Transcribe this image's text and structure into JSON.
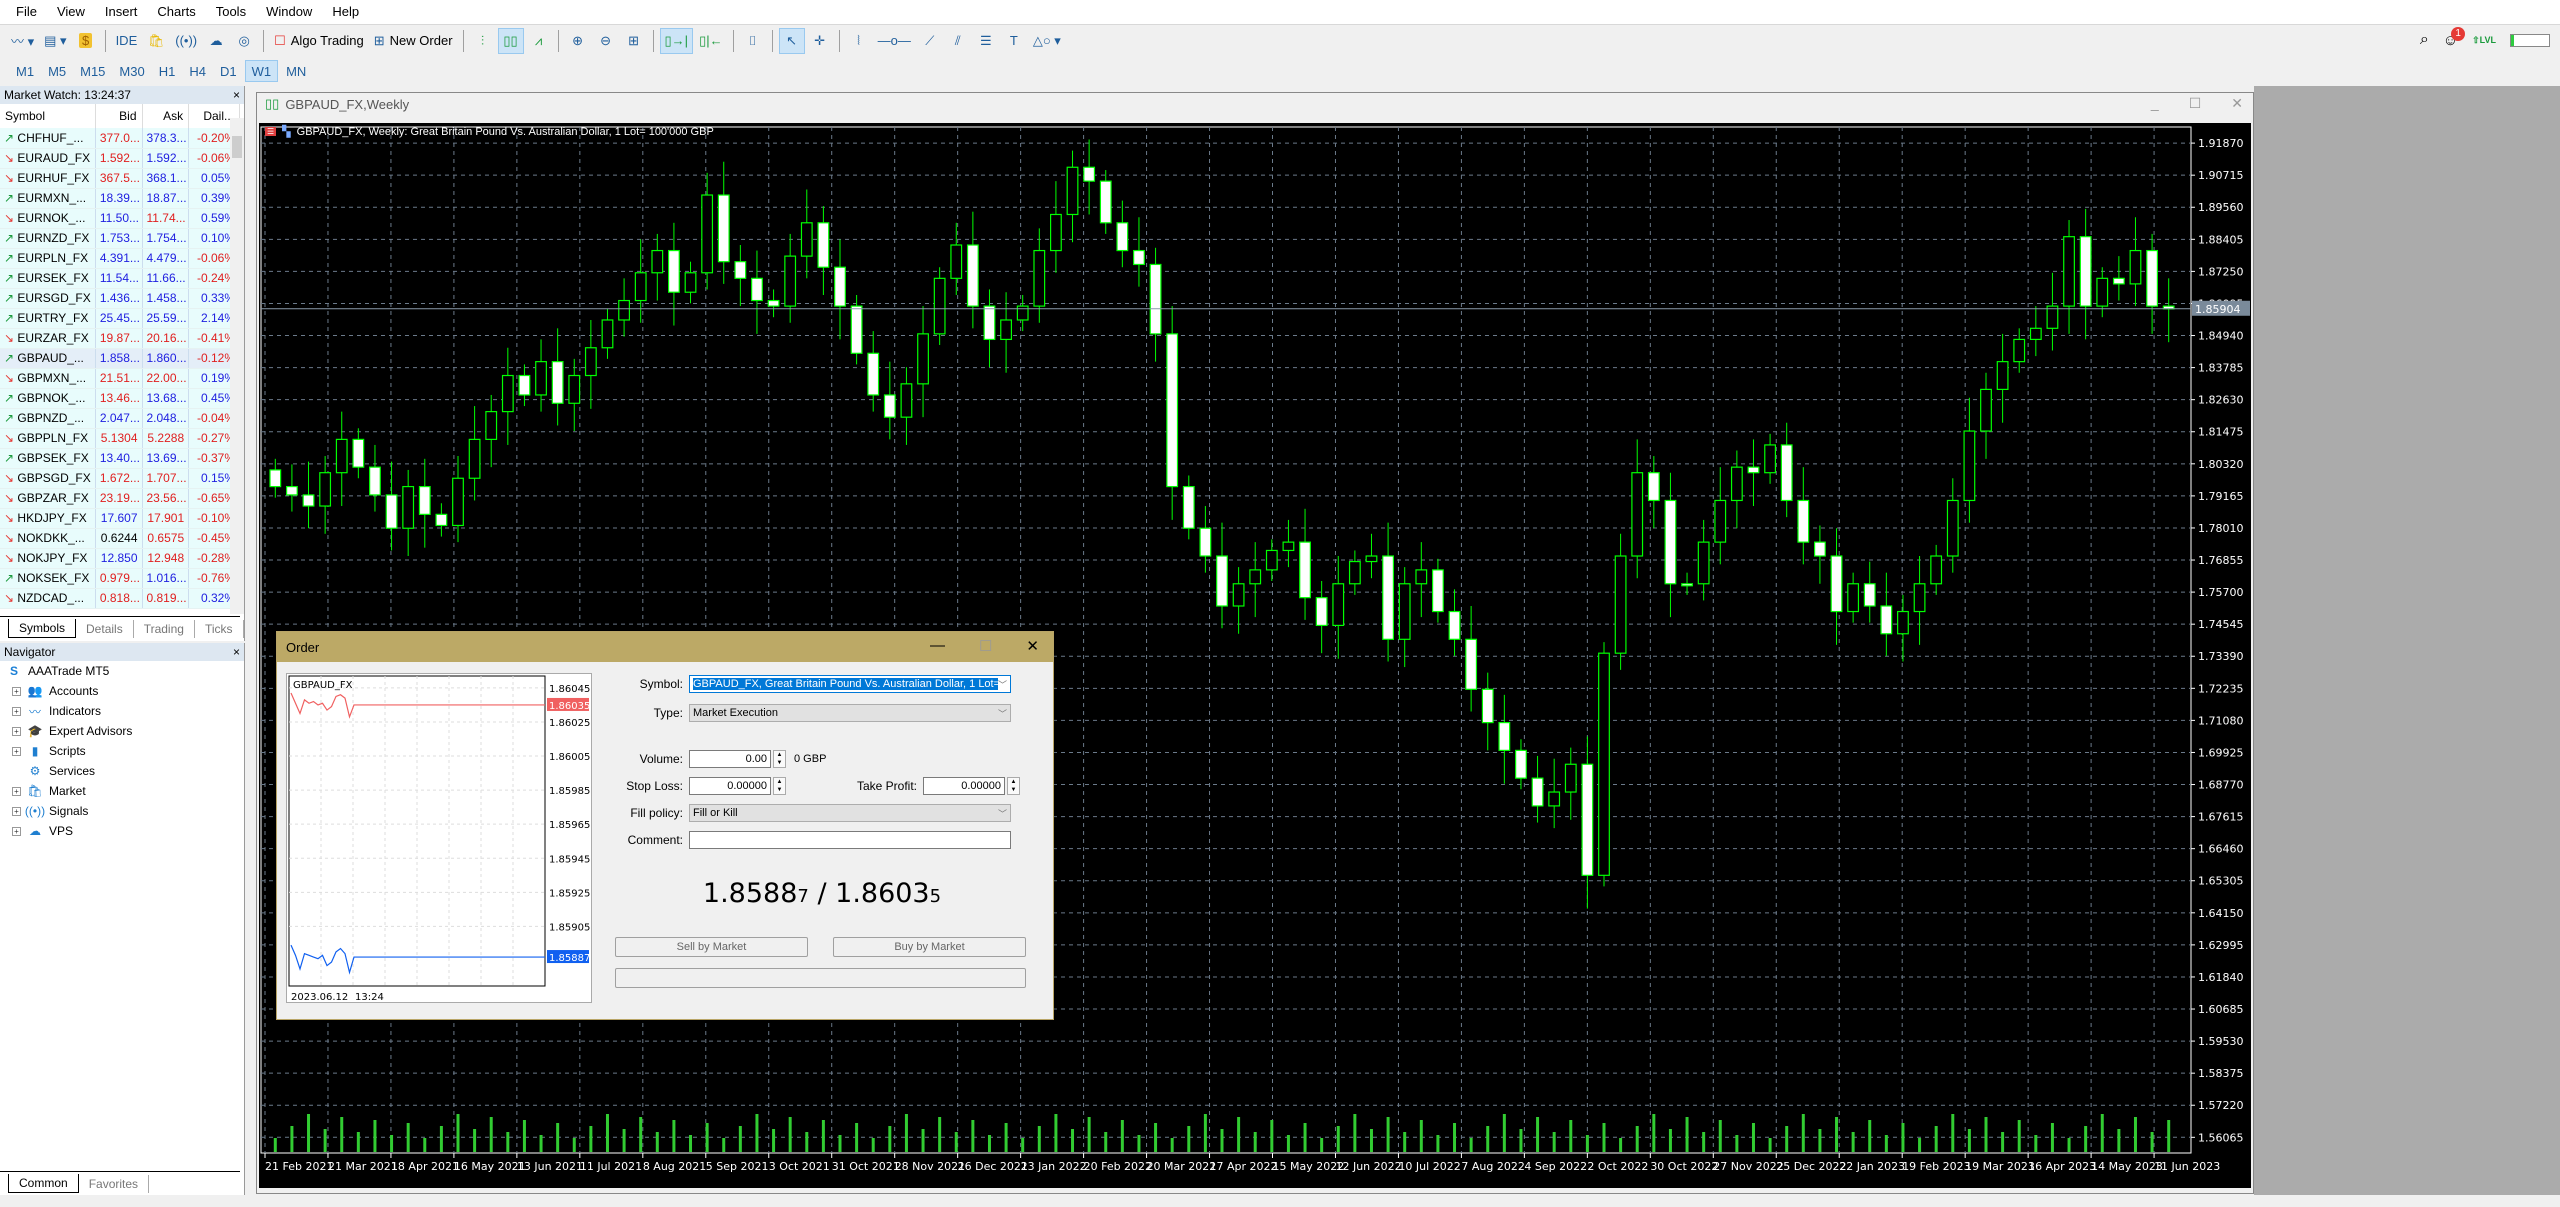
{
  "menu": [
    "File",
    "View",
    "Insert",
    "Charts",
    "Tools",
    "Window",
    "Help"
  ],
  "toolbar": {
    "ide_label": "IDE",
    "algo_trading_label": "Algo Trading",
    "new_order_label": "New Order",
    "notifications_count": "1"
  },
  "timeframes": [
    "M1",
    "M5",
    "M15",
    "M30",
    "H1",
    "H4",
    "D1",
    "W1",
    "MN"
  ],
  "active_timeframe": "W1",
  "market_watch": {
    "title": "Market Watch: 13:24:37",
    "columns": [
      "Symbol",
      "Bid",
      "Ask",
      "Dail..."
    ],
    "rows": [
      {
        "symbol": "CHFHUF_...",
        "dir": "up",
        "bid": "377.0...",
        "bid_c": "red",
        "ask": "378.3...",
        "ask_c": "blue",
        "daily": "-0.20%",
        "daily_c": "red"
      },
      {
        "symbol": "EURAUD_FX",
        "dir": "dn",
        "bid": "1.592...",
        "bid_c": "red",
        "ask": "1.592...",
        "ask_c": "blue",
        "daily": "-0.06%",
        "daily_c": "red"
      },
      {
        "symbol": "EURHUF_FX",
        "dir": "dn",
        "bid": "367.5...",
        "bid_c": "red",
        "ask": "368.1...",
        "ask_c": "blue",
        "daily": "0.05%",
        "daily_c": "blue"
      },
      {
        "symbol": "EURMXN_...",
        "dir": "up",
        "bid": "18.39...",
        "bid_c": "blue",
        "ask": "18.87...",
        "ask_c": "blue",
        "daily": "0.39%",
        "daily_c": "blue"
      },
      {
        "symbol": "EURNOK_...",
        "dir": "dn",
        "bid": "11.50...",
        "bid_c": "blue",
        "ask": "11.74...",
        "ask_c": "red",
        "daily": "0.59%",
        "daily_c": "blue"
      },
      {
        "symbol": "EURNZD_FX",
        "dir": "up",
        "bid": "1.753...",
        "bid_c": "blue",
        "ask": "1.754...",
        "ask_c": "blue",
        "daily": "0.10%",
        "daily_c": "blue"
      },
      {
        "symbol": "EURPLN_FX",
        "dir": "up",
        "bid": "4.391...",
        "bid_c": "blue",
        "ask": "4.479...",
        "ask_c": "blue",
        "daily": "-0.06%",
        "daily_c": "red"
      },
      {
        "symbol": "EURSEK_FX",
        "dir": "up",
        "bid": "11.54...",
        "bid_c": "blue",
        "ask": "11.66...",
        "ask_c": "blue",
        "daily": "-0.24%",
        "daily_c": "red"
      },
      {
        "symbol": "EURSGD_FX",
        "dir": "up",
        "bid": "1.436...",
        "bid_c": "blue",
        "ask": "1.458...",
        "ask_c": "blue",
        "daily": "0.33%",
        "daily_c": "blue"
      },
      {
        "symbol": "EURTRY_FX",
        "dir": "up",
        "bid": "25.45...",
        "bid_c": "blue",
        "ask": "25.59...",
        "ask_c": "blue",
        "daily": "2.14%",
        "daily_c": "blue"
      },
      {
        "symbol": "EURZAR_FX",
        "dir": "dn",
        "bid": "19.87...",
        "bid_c": "red",
        "ask": "20.16...",
        "ask_c": "red",
        "daily": "-0.41%",
        "daily_c": "red"
      },
      {
        "symbol": "GBPAUD_...",
        "dir": "up",
        "bid": "1.858...",
        "bid_c": "blue",
        "ask": "1.860...",
        "ask_c": "blue",
        "daily": "-0.12%",
        "daily_c": "red",
        "selected": true
      },
      {
        "symbol": "GBPMXN_...",
        "dir": "dn",
        "bid": "21.51...",
        "bid_c": "red",
        "ask": "22.00...",
        "ask_c": "red",
        "daily": "0.19%",
        "daily_c": "blue"
      },
      {
        "symbol": "GBPNOK_...",
        "dir": "up",
        "bid": "13.46...",
        "bid_c": "red",
        "ask": "13.68...",
        "ask_c": "blue",
        "daily": "0.45%",
        "daily_c": "blue"
      },
      {
        "symbol": "GBPNZD_...",
        "dir": "up",
        "bid": "2.047...",
        "bid_c": "blue",
        "ask": "2.048...",
        "ask_c": "blue",
        "daily": "-0.04%",
        "daily_c": "red"
      },
      {
        "symbol": "GBPPLN_FX",
        "dir": "dn",
        "bid": "5.1304",
        "bid_c": "red",
        "ask": "5.2288",
        "ask_c": "red",
        "daily": "-0.27%",
        "daily_c": "red"
      },
      {
        "symbol": "GBPSEK_FX",
        "dir": "up",
        "bid": "13.40...",
        "bid_c": "blue",
        "ask": "13.69...",
        "ask_c": "blue",
        "daily": "-0.37%",
        "daily_c": "red"
      },
      {
        "symbol": "GBPSGD_FX",
        "dir": "dn",
        "bid": "1.672...",
        "bid_c": "red",
        "ask": "1.707...",
        "ask_c": "red",
        "daily": "0.15%",
        "daily_c": "blue"
      },
      {
        "symbol": "GBPZAR_FX",
        "dir": "dn",
        "bid": "23.19...",
        "bid_c": "red",
        "ask": "23.56...",
        "ask_c": "red",
        "daily": "-0.65%",
        "daily_c": "red"
      },
      {
        "symbol": "HKDJPY_FX",
        "dir": "dn",
        "bid": "17.607",
        "bid_c": "blue",
        "ask": "17.901",
        "ask_c": "red",
        "daily": "-0.10%",
        "daily_c": "red"
      },
      {
        "symbol": "NOKDKK_...",
        "dir": "dn",
        "bid": "0.6244",
        "bid_c": "blk",
        "ask": "0.6575",
        "ask_c": "red",
        "daily": "-0.45%",
        "daily_c": "red"
      },
      {
        "symbol": "NOKJPY_FX",
        "dir": "dn",
        "bid": "12.850",
        "bid_c": "blue",
        "ask": "12.948",
        "ask_c": "red",
        "daily": "-0.28%",
        "daily_c": "red"
      },
      {
        "symbol": "NOKSEK_FX",
        "dir": "up",
        "bid": "0.979...",
        "bid_c": "red",
        "ask": "1.016...",
        "ask_c": "blue",
        "daily": "-0.76%",
        "daily_c": "red"
      },
      {
        "symbol": "NZDCAD_...",
        "dir": "dn",
        "bid": "0.818...",
        "bid_c": "red",
        "ask": "0.819...",
        "ask_c": "red",
        "daily": "0.32%",
        "daily_c": "blue"
      }
    ],
    "tabs": [
      "Symbols",
      "Details",
      "Trading",
      "Ticks"
    ],
    "active_tab": "Symbols"
  },
  "navigator": {
    "title": "Navigator",
    "root": "AAATrade MT5",
    "items": [
      {
        "label": "Accounts",
        "icon": "accounts-icon",
        "glyph": "👥",
        "expandable": true
      },
      {
        "label": "Indicators",
        "icon": "indicators-icon",
        "glyph": "〰",
        "expandable": true
      },
      {
        "label": "Expert Advisors",
        "icon": "expert-advisors-icon",
        "glyph": "🎓",
        "expandable": true
      },
      {
        "label": "Scripts",
        "icon": "scripts-icon",
        "glyph": "▮",
        "expandable": true
      },
      {
        "label": "Services",
        "icon": "services-icon",
        "glyph": "⚙",
        "expandable": false
      },
      {
        "label": "Market",
        "icon": "market-icon",
        "glyph": "🛍",
        "expandable": true
      },
      {
        "label": "Signals",
        "icon": "signals-icon",
        "glyph": "((•))",
        "expandable": true
      },
      {
        "label": "VPS",
        "icon": "vps-icon",
        "glyph": "☁",
        "expandable": true
      }
    ],
    "tabs": [
      "Common",
      "Favorites"
    ],
    "active_tab": "Common"
  },
  "chart": {
    "window_title": "GBPAUD_FX,Weekly",
    "info_text": "GBPAUD_FX, Weekly:  Great Britain Pound Vs. Australian Dollar, 1 Lot= 100'000 GBP",
    "current_price_label": "1.85904"
  },
  "chart_data": {
    "type": "candlestick",
    "symbol": "GBPAUD_FX",
    "timeframe": "Weekly",
    "ylim": [
      1.555,
      1.9245
    ],
    "y_ticks": [
      "1.91870",
      "1.90715",
      "1.89560",
      "1.88405",
      "1.87250",
      "1.86095",
      "1.84940",
      "1.83785",
      "1.82630",
      "1.81475",
      "1.80320",
      "1.79165",
      "1.78010",
      "1.76855",
      "1.75700",
      "1.74545",
      "1.73390",
      "1.72235",
      "1.71080",
      "1.69925",
      "1.68770",
      "1.67615",
      "1.66460",
      "1.65305",
      "1.64150",
      "1.62995",
      "1.61840",
      "1.60685",
      "1.59530",
      "1.58375",
      "1.57220",
      "1.56065"
    ],
    "x_ticks": [
      "21 Feb 2021",
      "21 Mar 2021",
      "18 Apr 2021",
      "16 May 2021",
      "13 Jun 2021",
      "11 Jul 2021",
      "8 Aug 2021",
      "5 Sep 2021",
      "3 Oct 2021",
      "31 Oct 2021",
      "28 Nov 2021",
      "26 Dec 2021",
      "23 Jan 2022",
      "20 Feb 2022",
      "20 Mar 2022",
      "17 Apr 2022",
      "15 May 2022",
      "12 Jun 2022",
      "10 Jul 2022",
      "7 Aug 2022",
      "4 Sep 2022",
      "2 Oct 2022",
      "30 Oct 2022",
      "27 Nov 2022",
      "25 Dec 2022",
      "22 Jan 2023",
      "19 Feb 2023",
      "19 Mar 2023",
      "16 Apr 2023",
      "14 May 2023",
      "11 Jun 2023"
    ],
    "closes": [
      1.795,
      1.792,
      1.788,
      1.8,
      1.812,
      1.802,
      1.792,
      1.78,
      1.795,
      1.785,
      1.781,
      1.798,
      1.812,
      1.822,
      1.835,
      1.828,
      1.84,
      1.825,
      1.835,
      1.845,
      1.855,
      1.862,
      1.872,
      1.88,
      1.865,
      1.872,
      1.9,
      1.876,
      1.87,
      1.862,
      1.86,
      1.878,
      1.89,
      1.874,
      1.86,
      1.843,
      1.828,
      1.82,
      1.832,
      1.85,
      1.87,
      1.882,
      1.86,
      1.848,
      1.855,
      1.86,
      1.88,
      1.893,
      1.91,
      1.905,
      1.89,
      1.88,
      1.875,
      1.85,
      1.795,
      1.78,
      1.77,
      1.752,
      1.76,
      1.765,
      1.772,
      1.775,
      1.755,
      1.745,
      1.76,
      1.768,
      1.77,
      1.74,
      1.76,
      1.765,
      1.75,
      1.74,
      1.722,
      1.71,
      1.7,
      1.69,
      1.68,
      1.685,
      1.695,
      1.655,
      1.735,
      1.77,
      1.8,
      1.79,
      1.76,
      1.76,
      1.775,
      1.79,
      1.802,
      1.8,
      1.81,
      1.79,
      1.775,
      1.77,
      1.75,
      1.76,
      1.752,
      1.742,
      1.75,
      1.76,
      1.77,
      1.79,
      1.815,
      1.83,
      1.84,
      1.848,
      1.852,
      1.86,
      1.885,
      1.86,
      1.87,
      1.868,
      1.88,
      1.86,
      1.859
    ],
    "last_price": 1.85904
  },
  "order": {
    "title": "Order",
    "mini_chart": {
      "symbol": "GBPAUD_FX",
      "y_ticks": [
        "1.86045",
        "1.86025",
        "1.86005",
        "1.85985",
        "1.85965",
        "1.85945",
        "1.85925",
        "1.85905"
      ],
      "ask_label": "1.86035",
      "bid_label": "1.85887",
      "x_labels": [
        "2023.06.12",
        "13:24"
      ],
      "ask_series": [
        1.86042,
        1.86036,
        1.8603,
        1.86038,
        1.86036,
        1.86037,
        1.86035,
        1.86036,
        1.86032,
        1.86034,
        1.8604,
        1.86041,
        1.86039,
        1.86028,
        1.86035,
        1.86035,
        1.86035
      ],
      "bid_series": [
        1.85894,
        1.85888,
        1.8588,
        1.85889,
        1.85888,
        1.85887,
        1.85886,
        1.85888,
        1.85882,
        1.85884,
        1.8589,
        1.85892,
        1.85889,
        1.85878,
        1.85887,
        1.85887,
        1.85887
      ]
    },
    "symbol_label": "Symbol:",
    "symbol_value": "GBPAUD_FX, Great Britain Pound Vs. Australian Dollar, 1 Lot=",
    "type_label": "Type:",
    "type_value": "Market Execution",
    "volume_label": "Volume:",
    "volume_value": "0.00",
    "volume_unit": "0 GBP",
    "sl_label": "Stop Loss:",
    "sl_value": "0.00000",
    "tp_label": "Take Profit:",
    "tp_value": "0.00000",
    "fill_label": "Fill policy:",
    "fill_value": "Fill or Kill",
    "comment_label": "Comment:",
    "comment_value": "",
    "bid_main": "1.8588",
    "bid_small": "7",
    "ask_main": "1.8603",
    "ask_small": "5",
    "sell_label": "Sell by Market",
    "buy_label": "Buy by Market"
  }
}
